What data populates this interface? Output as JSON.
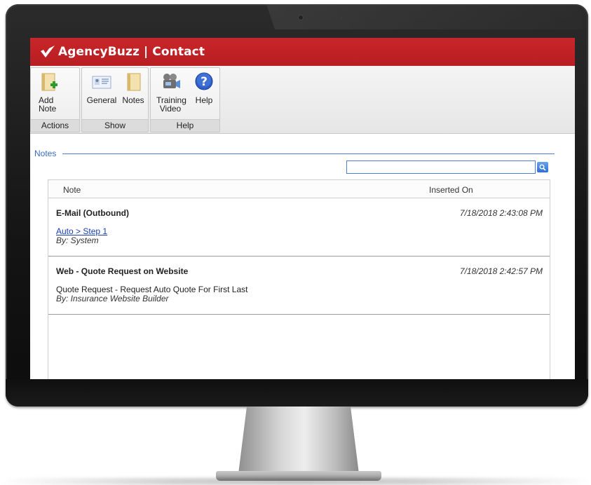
{
  "app": {
    "brand_title": "AgencyBuzz | Contact",
    "accent_color": "#c0222a"
  },
  "ribbon": {
    "groups": [
      {
        "label": "Actions",
        "buttons": [
          {
            "label": "Add Note",
            "icon": "add-note-icon"
          }
        ]
      },
      {
        "label": "Show",
        "buttons": [
          {
            "label": "General",
            "icon": "contact-card-icon"
          },
          {
            "label": "Notes",
            "icon": "notepad-icon"
          }
        ]
      },
      {
        "label": "Help",
        "buttons": [
          {
            "label": "Training Video",
            "icon": "video-camera-icon"
          },
          {
            "label": "Help",
            "icon": "help-question-icon"
          }
        ]
      }
    ]
  },
  "notes": {
    "section_label": "Notes",
    "search": {
      "value": "",
      "placeholder": ""
    },
    "columns": {
      "note": "Note",
      "inserted_on": "Inserted On"
    },
    "rows": [
      {
        "title": "E-Mail (Outbound)",
        "inserted_on": "7/18/2018 2:43:08 PM",
        "link_text": "Auto > Step 1",
        "by": "By: System"
      },
      {
        "title": "Web - Quote Request on Website",
        "inserted_on": "7/18/2018 2:42:57 PM",
        "body": "Quote Request - Request Auto Quote For First Last",
        "by": "By: Insurance Website Builder"
      }
    ]
  }
}
